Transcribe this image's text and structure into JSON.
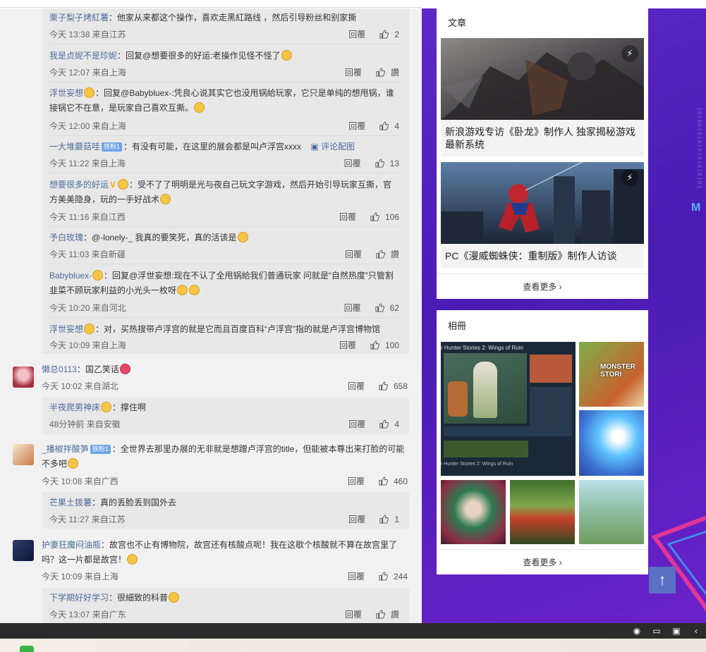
{
  "labels": {
    "reply": "回覆",
    "like_empty": "讚"
  },
  "replies_block1": [
    {
      "user": "栗子梨子烤紅薯",
      "badge": "",
      "text": "：他家从来都这个操作，喜欢走黑紅路线 ，然后引导粉丝和别家撕",
      "time": "今天 13:38 来自江苏",
      "likes": "2"
    },
    {
      "user": "我是贞妮不是珍妮",
      "badge": "",
      "text": "：回复@想要很多的好运:老操作见怪不怪了",
      "time": "今天 12:07 来自上海",
      "likes": "讚"
    },
    {
      "user": "浮世妄想",
      "badge": "",
      "text": "：回复@Babybluex-:凭良心说其实它也没甩锅給玩家，它只是单纯的想甩锅，谁接锅它不在意，是玩家自己喜欢互撕。",
      "time": "今天 12:00 来自上海",
      "likes": "4"
    },
    {
      "user": "一大堆蘑菇哇",
      "badge": "铁粉1",
      "text": "：有没有可能，在这里的展会都是叫卢浮宫xxxx",
      "extra": "评论配图",
      "time": "今天 11:22 来自上海",
      "likes": "13"
    },
    {
      "user": "想要很多的好运",
      "badge": "",
      "text": "：受不了了明明是光与夜自己玩文字游戏，然后开始引导玩家互撕，官方美美隐身，玩的一手好战术",
      "time": "今天 11:16 来自江西",
      "likes": "106"
    },
    {
      "user": "予白玫瑰",
      "badge": "",
      "text": "：@-lonely-_ 我真的要笑死，真的活该是",
      "time": "今天 11:03 来自新疆",
      "likes": "讚"
    },
    {
      "user": "Babybluex-",
      "badge": "",
      "text": "：回复@浮世妄想:现在不认了全甩锅給我们普通玩家 问就是“自然热度”只管割韭菜不顾玩家利益的小光头一枚呀",
      "time": "今天 10:20 来自河北",
      "likes": "62"
    },
    {
      "user": "浮世妄想",
      "badge": "",
      "text": "：对，买热搜带卢浮宫的就是它而且百度百科“卢浮宫”指的就是卢浮宫博物馆",
      "time": "今天 10:09 来自上海",
      "likes": "100"
    }
  ],
  "top_comments": [
    {
      "user": "懒总0113",
      "badge": "",
      "text": "：国乙笑话",
      "time": "今天 10:02 来自湖北",
      "likes": "658",
      "replies": [
        {
          "user": "半夜爬男神床",
          "text": "：撑住啊",
          "time": "48分钟前 来自安徽",
          "likes": "4"
        }
      ]
    },
    {
      "user": "_播椒拌酸笋",
      "badge": "铁粉1",
      "text": "：全世界去那里办展的无非就是想蹭卢浮宫的title，但能被本尊出来打脸的可能不多吧",
      "time": "今天 10:08 来自广西",
      "likes": "460",
      "replies": [
        {
          "user": "芒果土拨薯",
          "text": "：真的丢脸丢到国外去",
          "time": "今天 11:27 来自江苏",
          "likes": "1"
        }
      ]
    },
    {
      "user": "护妻狂魔闷油瓶",
      "badge": "",
      "text": "：故宫也不止有博物院，故宫还有核酸点呢！我在这歇个核酸就不算在故宫里了吗？这一片都是故宫！",
      "time": "今天 10:09 来自上海",
      "likes": "244",
      "replies": [
        {
          "user": "下学期好好学习",
          "text": "：很細致的科普",
          "time": "今天 13:07 来自广东",
          "likes": "讚"
        }
      ]
    }
  ],
  "articles_card": {
    "title": "文章",
    "items": [
      {
        "title": "新浪游戏专访《卧龙》制作人 独家揭秘游戏最新系统"
      },
      {
        "title": "PC《漫威蜘蛛侠：重制版》制作人访谈"
      }
    ],
    "more": "查看更多"
  },
  "album_card": {
    "title": "相冊",
    "main_caption": "r Hunter Stories 2: Wings of Ruin",
    "thumb_caption": "MONSTER STORI",
    "more": "查看更多"
  },
  "colors": {
    "link": "#4e6b9b",
    "accent_bg": "#5d27c7",
    "backtop": "#5b6fc4"
  }
}
